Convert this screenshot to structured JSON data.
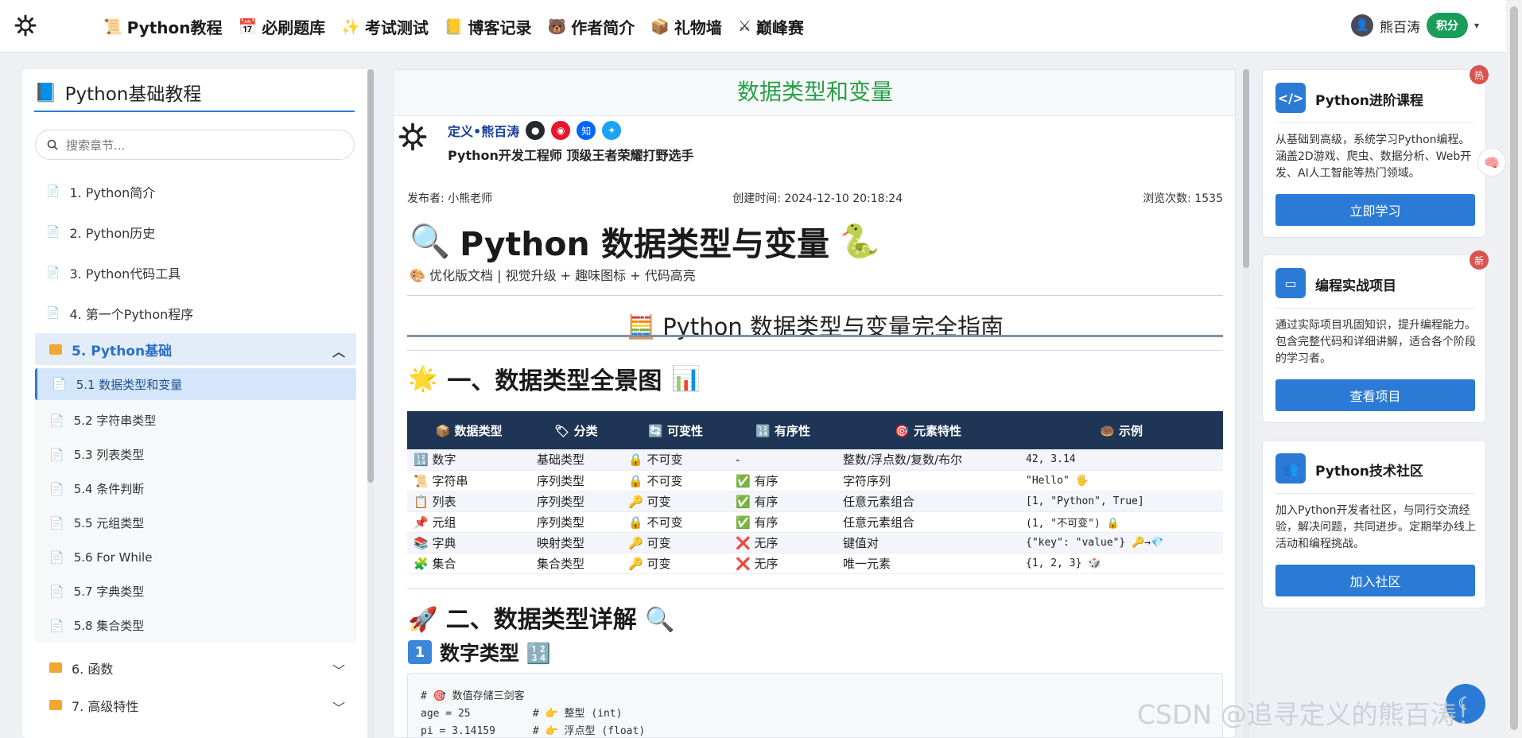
{
  "topbar": {
    "nav": [
      {
        "icon": "📜",
        "label": "Python教程"
      },
      {
        "icon": "📅",
        "label": "必刷题库"
      },
      {
        "icon": "✨",
        "label": "考试测试"
      },
      {
        "icon": "📒",
        "label": "博客记录"
      },
      {
        "icon": "🐻",
        "label": "作者简介"
      },
      {
        "icon": "📦",
        "label": "礼物墙"
      },
      {
        "icon": "⚔",
        "label": "巅峰赛"
      }
    ],
    "user_name": "熊百涛",
    "points_label": "积分"
  },
  "sidebar": {
    "title": "Python基础教程",
    "search_placeholder": "搜索章节...",
    "items": [
      {
        "label": "1. Python简介"
      },
      {
        "label": "2. Python历史"
      },
      {
        "label": "3. Python代码工具"
      },
      {
        "label": "4. 第一个Python程序"
      }
    ],
    "open_folder": "5. Python基础",
    "sub_items": [
      {
        "label": "5.1 数据类型和变量"
      },
      {
        "label": "5.2 字符串类型"
      },
      {
        "label": "5.3 列表类型"
      },
      {
        "label": "5.4 条件判断"
      },
      {
        "label": "5.5 元组类型"
      },
      {
        "label": "5.6 For While"
      },
      {
        "label": "5.7 字典类型"
      },
      {
        "label": "5.8 集合类型"
      }
    ],
    "folders": [
      {
        "label": "6. 函数"
      },
      {
        "label": "7. 高级特性"
      }
    ]
  },
  "article": {
    "header": "数据类型和变量",
    "author_name": "定义•熊百涛",
    "author_desc": "Python开发工程师 顶级王者荣耀打野选手",
    "social_zhi": "知",
    "publisher": "发布者: 小熊老师",
    "created": "创建时间: 2024-12-10 20:18:24",
    "views": "浏览次数: 1535",
    "title_icon_left": "🔍",
    "title": "Python 数据类型与变量",
    "title_icon_right": "🐍",
    "subtitle": "🎨 优化版文档 | 视觉升级 + 趣味图标 + 代码高亮",
    "guide_title": "🧮 Python 数据类型与变量完全指南",
    "section1_icon": "🌟",
    "section1": "一、数据类型全景图",
    "section1_icon2": "📊",
    "table_headers": [
      "📦 数据类型",
      "🏷 分类",
      "🔄 可变性",
      "🔢 有序性",
      "🎯 元素特性",
      "🍩 示例"
    ],
    "table_rows": [
      [
        "🔢 数字",
        "基础类型",
        "🔒 不可变",
        "-",
        "整数/浮点数/复数/布尔",
        "42, 3.14"
      ],
      [
        "📜 字符串",
        "序列类型",
        "🔒 不可变",
        "✅ 有序",
        "字符序列",
        "\"Hello\" 🖐"
      ],
      [
        "📋 列表",
        "序列类型",
        "🔑 可变",
        "✅ 有序",
        "任意元素组合",
        "[1, \"Python\", True]"
      ],
      [
        "📌 元组",
        "序列类型",
        "🔒 不可变",
        "✅ 有序",
        "任意元素组合",
        "(1, \"不可变\") 🔒"
      ],
      [
        "📚 字典",
        "映射类型",
        "🔑 可变",
        "❌ 无序",
        "键值对",
        "{\"key\": \"value\"} 🔑→💎"
      ],
      [
        "🧩 集合",
        "集合类型",
        "🔑 可变",
        "❌ 无序",
        "唯一元素",
        "{1, 2, 3} 🎲"
      ]
    ],
    "section2": "🚀 二、数据类型详解 🔍",
    "section2_sub_num": "1",
    "section2_sub": "数字类型 🔢",
    "code_lines": [
      "# 🎯 数值存储三剑客",
      "age = 25          # 👉 整型 (int)",
      "pi = 3.14159      # 👉 浮点型 (float)"
    ]
  },
  "cards": [
    {
      "icon": "</>",
      "title": "Python进阶课程",
      "desc": "从基础到高级，系统学习Python编程。涵盖2D游戏、爬虫、数据分析、Web开发、AI人工智能等热门领域。",
      "button": "立即学习",
      "badge": "热"
    },
    {
      "icon": "▭",
      "title": "编程实战项目",
      "desc": "通过实际项目巩固知识，提升编程能力。包含完整代码和详细讲解，适合各个阶段的学习者。",
      "button": "查看项目",
      "badge": "新"
    },
    {
      "icon": "👥",
      "title": "Python技术社区",
      "desc": "加入Python开发者社区，与同行交流经验，解决问题，共同进步。定期举办线上活动和编程挑战。",
      "button": "加入社区",
      "badge": ""
    }
  ],
  "watermark": "CSDN @追寻定义的熊百涛！"
}
